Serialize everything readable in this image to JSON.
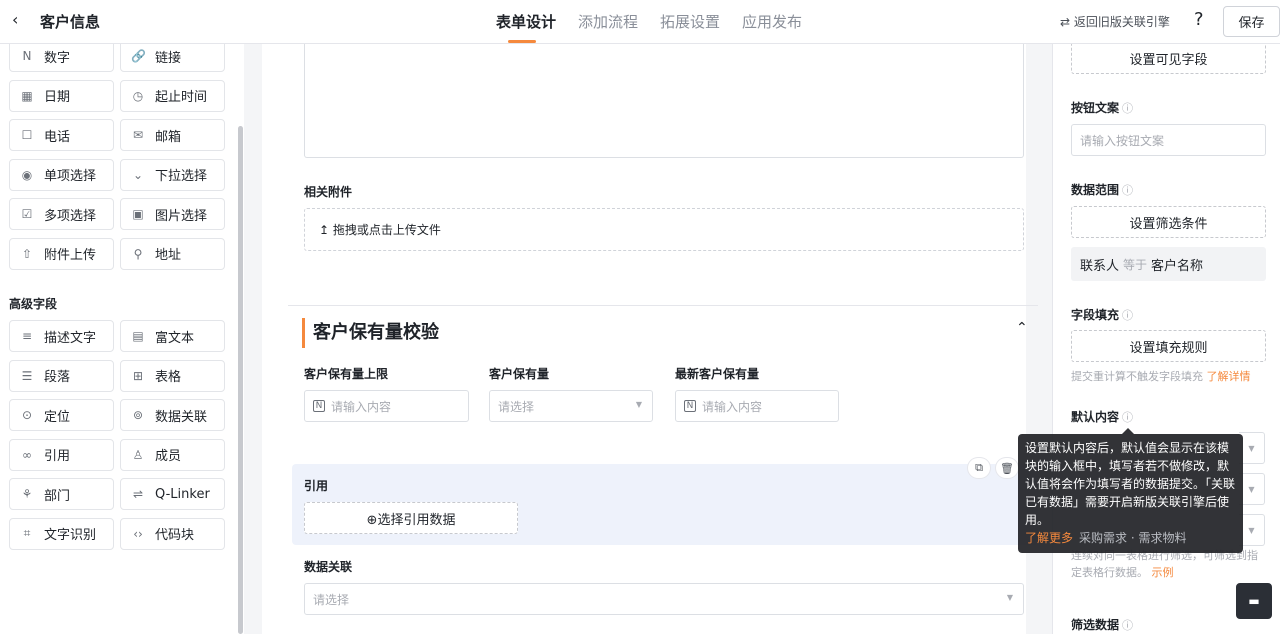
{
  "header": {
    "back_icon": "chevron-left-icon",
    "title": "客户信息",
    "tabs": [
      {
        "label": "表单设计",
        "active": true
      },
      {
        "label": "添加流程",
        "active": false
      },
      {
        "label": "拓展设置",
        "active": false
      },
      {
        "label": "应用发布",
        "active": false
      }
    ],
    "legacy_link": "⇄ 返回旧版关联引擎",
    "help_icon": "question-icon",
    "save_label": "保存"
  },
  "palette": {
    "basic_fields": [
      {
        "label": "数字",
        "icon": "N"
      },
      {
        "label": "链接",
        "icon": "🔗"
      },
      {
        "label": "日期",
        "icon": "▦"
      },
      {
        "label": "起止时间",
        "icon": "◷"
      },
      {
        "label": "电话",
        "icon": "☐"
      },
      {
        "label": "邮箱",
        "icon": "✉"
      },
      {
        "label": "单项选择",
        "icon": "◉"
      },
      {
        "label": "下拉选择",
        "icon": "⌄"
      },
      {
        "label": "多项选择",
        "icon": "☑"
      },
      {
        "label": "图片选择",
        "icon": "▣"
      },
      {
        "label": "附件上传",
        "icon": "⇧"
      },
      {
        "label": "地址",
        "icon": "⚲"
      }
    ],
    "advanced_title": "高级字段",
    "advanced_fields": [
      {
        "label": "描述文字",
        "icon": "≡"
      },
      {
        "label": "富文本",
        "icon": "▤"
      },
      {
        "label": "段落",
        "icon": "☰"
      },
      {
        "label": "表格",
        "icon": "⊞"
      },
      {
        "label": "定位",
        "icon": "⊙"
      },
      {
        "label": "数据关联",
        "icon": "⊚"
      },
      {
        "label": "引用",
        "icon": "∞"
      },
      {
        "label": "成员",
        "icon": "♙"
      },
      {
        "label": "部门",
        "icon": "⚘"
      },
      {
        "label": "Q-Linker",
        "icon": "⇌"
      },
      {
        "label": "文字识别",
        "icon": "⌗"
      },
      {
        "label": "代码块",
        "icon": "‹›"
      }
    ]
  },
  "form": {
    "attachment_label": "相关附件",
    "upload_text": "↥ 拖拽或点击上传文件",
    "section_title": "客户保有量校验",
    "collapse_icon": "chevron-up-icon",
    "fields": [
      {
        "label": "客户保有量上限",
        "placeholder": "请输入内容",
        "type": "number"
      },
      {
        "label": "客户保有量",
        "placeholder": "请选择",
        "type": "select"
      },
      {
        "label": "最新客户保有量",
        "placeholder": "请输入内容",
        "type": "number"
      }
    ],
    "reference_label": "引用",
    "reference_button": "⊕选择引用数据",
    "data_link_label": "数据关联",
    "data_link_placeholder": "请选择"
  },
  "settings": {
    "visible_fields_btn": "设置可见字段",
    "button_text_label": "按钮文案",
    "button_text_placeholder": "请输入按钮文案",
    "data_range_label": "数据范围",
    "filter_btn": "设置筛选条件",
    "condition": {
      "field": "联系人",
      "op": "等于",
      "value": "客户名称"
    },
    "field_fill_label": "字段填充",
    "fill_rule_btn": "设置填充规则",
    "fill_hint": "提交重计算不触发字段填充",
    "fill_hint_link": "了解详情",
    "default_label": "默认内容",
    "filter_hint": "连续对同一表格进行筛选，可筛选到指定表格行数据。",
    "filter_hint_link": "示例",
    "filter_data_label": "筛选数据"
  },
  "tooltip": {
    "text": "设置默认内容后，默认值会显示在该模块的输入框中，填写者若不做修改，默认值将会作为填写者的数据提交。「关联已有数据」需要开启新版关联引擎后使用。",
    "more": "了解更多",
    "behind_text": "采购需求 · 需求物料"
  },
  "chat_icon": "chat-icon"
}
